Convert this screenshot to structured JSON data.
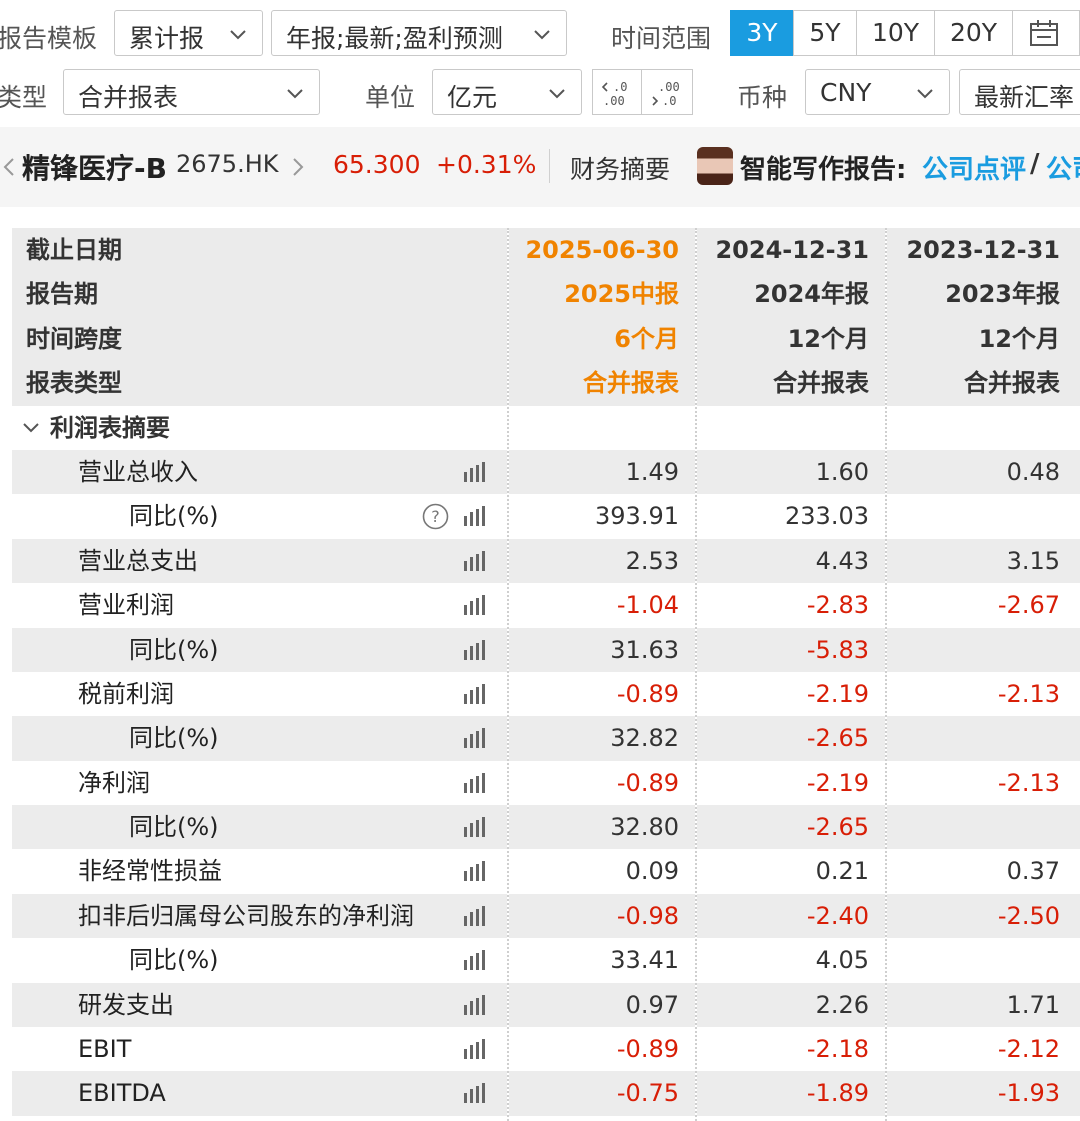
{
  "toolbar": {
    "report_template_label": "报告模板",
    "report_template_value": "累计报",
    "report_kind_value": "年报;最新;盈利预测",
    "time_range_label": "时间范围",
    "time_ranges": [
      "3Y",
      "5Y",
      "10Y",
      "20Y"
    ],
    "time_range_active": "3Y",
    "type_label": "类型",
    "type_value": "合并报表",
    "unit_label": "单位",
    "unit_value": "亿元",
    "decimal_icons": [
      "increase-decimal-icon",
      "decrease-decimal-icon"
    ],
    "currency_label": "币种",
    "currency_value": "CNY",
    "fx_rate_label": "最新汇率"
  },
  "quote": {
    "name": "精锋医疗-B",
    "code": "2675.HK",
    "price": "65.300",
    "change": "+0.31%",
    "summary_label": "财务摘要",
    "ai_report_label": "智能写作报告:",
    "link_company_review": "公司点评",
    "slash": "/",
    "link_company_cut": "公司",
    "price_color": "#d81e06",
    "link_color": "#1a9ce0"
  },
  "header_rows": [
    {
      "label": "截止日期",
      "v1": "2025-06-30",
      "v2": "2024-12-31",
      "v3": "2023-12-31"
    },
    {
      "label": "报告期",
      "v1": "2025中报",
      "v2": "2024年报",
      "v3": "2023年报"
    },
    {
      "label": "时间跨度",
      "v1": "6个月",
      "v2": "12个月",
      "v3": "12个月"
    },
    {
      "label": "报表类型",
      "v1": "合并报表",
      "v2": "合并报表",
      "v3": "合并报表"
    }
  ],
  "section": {
    "title": "利润表摘要",
    "expanded": true
  },
  "rows": [
    {
      "label": "营业总收入",
      "level": 1,
      "v1": "1.49",
      "v2": "1.60",
      "v3": "0.48"
    },
    {
      "label": "同比(%)",
      "level": 2,
      "help": true,
      "v1": "393.91",
      "v2": "233.03",
      "v3": ""
    },
    {
      "label": "营业总支出",
      "level": 1,
      "v1": "2.53",
      "v2": "4.43",
      "v3": "3.15"
    },
    {
      "label": "营业利润",
      "level": 1,
      "v1": "-1.04",
      "v2": "-2.83",
      "v3": "-2.67"
    },
    {
      "label": "同比(%)",
      "level": 2,
      "v1": "31.63",
      "v2": "-5.83",
      "v3": ""
    },
    {
      "label": "税前利润",
      "level": 1,
      "v1": "-0.89",
      "v2": "-2.19",
      "v3": "-2.13"
    },
    {
      "label": "同比(%)",
      "level": 2,
      "v1": "32.82",
      "v2": "-2.65",
      "v3": ""
    },
    {
      "label": "净利润",
      "level": 1,
      "v1": "-0.89",
      "v2": "-2.19",
      "v3": "-2.13"
    },
    {
      "label": "同比(%)",
      "level": 2,
      "v1": "32.80",
      "v2": "-2.65",
      "v3": ""
    },
    {
      "label": "非经常性损益",
      "level": 1,
      "v1": "0.09",
      "v2": "0.21",
      "v3": "0.37"
    },
    {
      "label": "扣非后归属母公司股东的净利润",
      "level": 1,
      "v1": "-0.98",
      "v2": "-2.40",
      "v3": "-2.50"
    },
    {
      "label": "同比(%)",
      "level": 2,
      "v1": "33.41",
      "v2": "4.05",
      "v3": ""
    },
    {
      "label": "研发支出",
      "level": 1,
      "v1": "0.97",
      "v2": "2.26",
      "v3": "1.71"
    },
    {
      "label": "EBIT",
      "level": 1,
      "v1": "-0.89",
      "v2": "-2.18",
      "v3": "-2.12"
    },
    {
      "label": "EBITDA",
      "level": 1,
      "v1": "-0.75",
      "v2": "-1.89",
      "v3": "-1.93"
    }
  ],
  "colors": {
    "accent": "#1a9ce0",
    "latest_period": "#f08300",
    "negative": "#d81e06"
  }
}
